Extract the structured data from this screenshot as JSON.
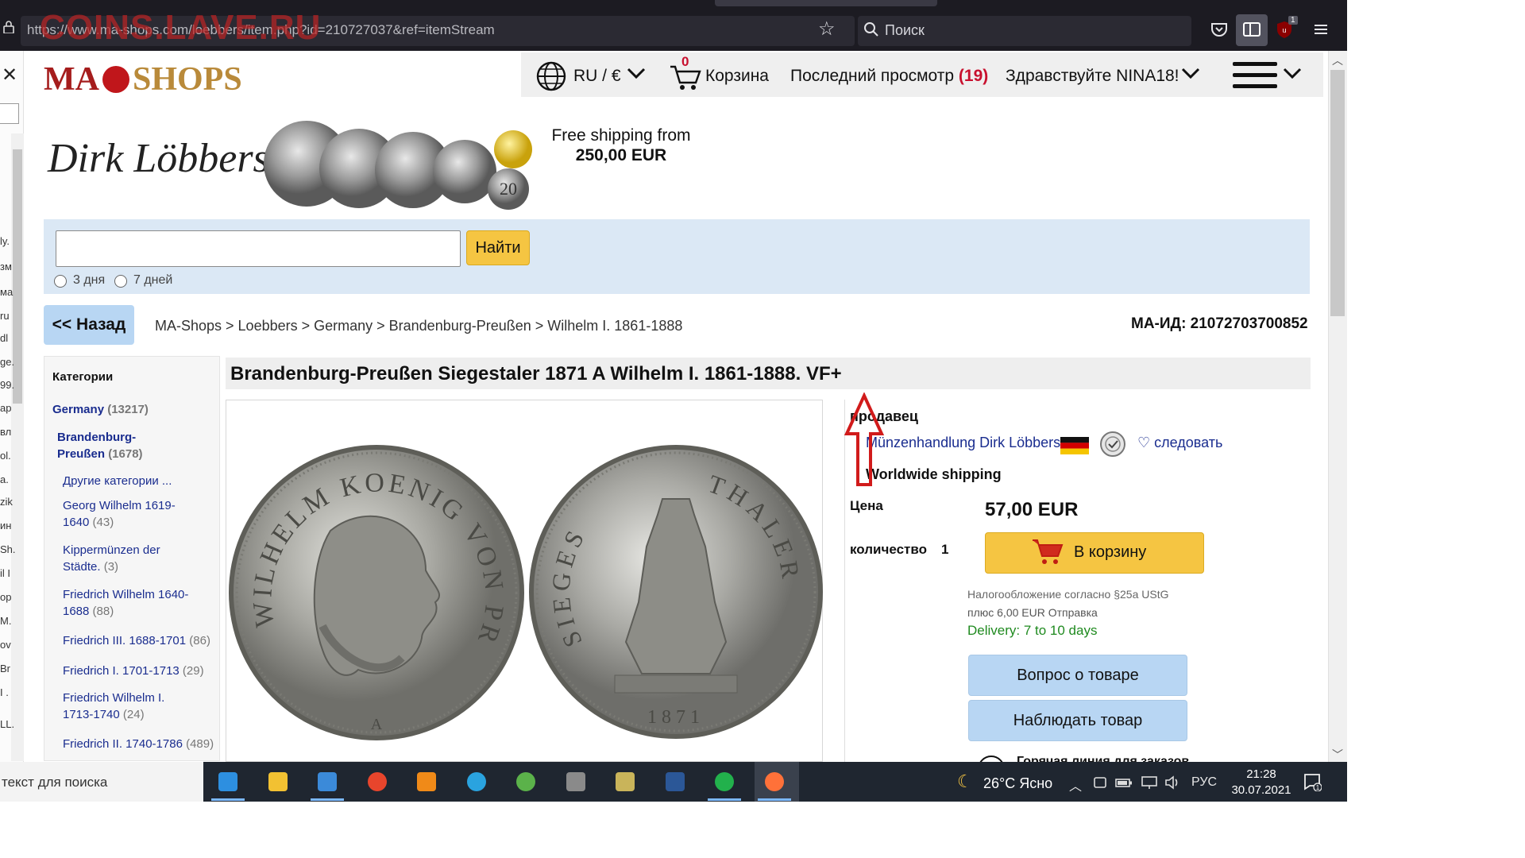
{
  "browser": {
    "url": "https://www.ma-shops.com/loebbers/item.php?id=210727037&ref=itemStream",
    "watermark": "COINS.LAVE.RU",
    "search_placeholder": "Поиск",
    "ublock_count": "1",
    "icons": [
      "lock-icon",
      "star-icon",
      "search-icon",
      "pocket-icon",
      "reader-view-icon",
      "ublock-icon",
      "menu-icon"
    ]
  },
  "sidebar": {
    "close": "✕",
    "fragments": [
      "ly.",
      "зм",
      "ма",
      "ru",
      "dl",
      "ge.",
      "99.",
      "ар",
      "вл",
      "ol.",
      "a.",
      "zik",
      "ин",
      "Sh.",
      "il I",
      "op",
      "M.",
      "ov",
      "Br",
      "I .",
      "LL."
    ]
  },
  "header": {
    "logo_ma": "MA",
    "logo_shops": "SHOPS",
    "locale": "RU / €",
    "cart_count": "0",
    "cart_label": "Корзина",
    "recent_label": "Последний просмотр",
    "recent_open": "(",
    "recent_count": "19",
    "recent_close": ")",
    "greeting": "Здравствуйте NINA18!"
  },
  "banner": {
    "dealer": "Dirk Löbbers",
    "coin_value": "20",
    "free_shipping_line1": "Free shipping from",
    "free_shipping_line2": "250,00 EUR"
  },
  "search": {
    "value": "",
    "button": "Найти",
    "radio_3": "3 дня",
    "radio_7": "7 дней"
  },
  "nav": {
    "back": "<< Назад",
    "breadcrumb": "MA-Shops > Loebbers > Germany > Brandenburg-Preußen > Wilhelm I. 1861-1888",
    "ma_id": "MA-ИД: 21072703700852"
  },
  "categories": {
    "title": "Категории",
    "items": [
      {
        "name": "Germany",
        "count": "(13217)",
        "bold": true
      },
      {
        "name": "Brandenburg-Preußen",
        "count": "(1678)",
        "bold": true
      },
      {
        "name": "Другие категории ...",
        "count": ""
      },
      {
        "name": "Georg Wilhelm 1619-1640",
        "count": "(43)"
      },
      {
        "name": "Kippermünzen der Städte.",
        "count": "(3)"
      },
      {
        "name": "Friedrich Wilhelm 1640-1688",
        "count": "(88)"
      },
      {
        "name": "Friedrich III. 1688-1701",
        "count": "(86)"
      },
      {
        "name": "Friedrich I. 1701-1713",
        "count": "(29)"
      },
      {
        "name": "Friedrich Wilhelm I. 1713-1740",
        "count": "(24)"
      },
      {
        "name": "Friedrich II. 1740-1786",
        "count": "(489)"
      }
    ]
  },
  "item": {
    "title": "Brandenburg-Preußen Siegestaler 1871 A Wilhelm I. 1861-1888. VF+",
    "obverse_legend": "WILHELM KOENIG VON PREUSSEN",
    "obverse_mint": "A",
    "reverse_legend_left": "SIEGES",
    "reverse_legend_right": "THALER",
    "reverse_year": "1871",
    "seller_heading": "продавец",
    "seller_name": "Münzenhandlung Dirk Löbbers",
    "follow": "следовать",
    "follow_icon": "heart-icon",
    "worldwide": "Worldwide shipping",
    "price_label": "Цена",
    "price": "57,00 EUR",
    "qty_label": "количество",
    "qty": "1",
    "cart_button": "В корзину",
    "tax_note": "Налогообложение согласно §25a UStG",
    "shipping_cost": "плюс 6,00 EUR Отправка",
    "delivery": "Delivery: 7 to 10 days",
    "question_button": "Вопрос о товаре",
    "watch_button": "Наблюдать товар",
    "cut_off_text": "Горячая линия для заказов"
  },
  "taskbar": {
    "search_text": "текст для поиска",
    "weather": "26°C  Ясно",
    "lang": "РУС",
    "time": "21:28",
    "date": "30.07.2021",
    "notif_count": "1",
    "apps": [
      "edge-icon",
      "explorer-icon",
      "mail-icon",
      "chrome-icon",
      "vlc-icon",
      "telegram-icon",
      "utorrent-icon",
      "archive-icon",
      "media-icon",
      "word-icon",
      "email-app-icon",
      "firefox-icon"
    ]
  },
  "colors": {
    "accent_yellow": "#f5c542",
    "accent_blue": "#b8d6f3",
    "link_blue": "#1a2d8f",
    "brand_red": "#c0161b",
    "delivery_green": "#1f8a1f"
  }
}
